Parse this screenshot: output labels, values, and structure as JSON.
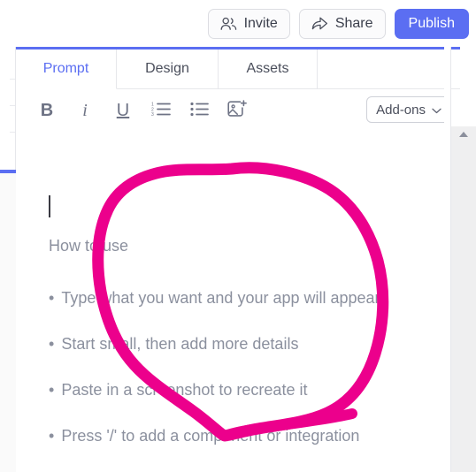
{
  "topbar": {
    "invite_label": "Invite",
    "invite_icon": "people-icon",
    "share_label": "Share",
    "share_icon": "share-arrow-icon",
    "publish_label": "Publish",
    "publish_color": "#5b6ef2"
  },
  "tabs": {
    "items": [
      {
        "label": "Prompt",
        "active": true
      },
      {
        "label": "Design",
        "active": false
      },
      {
        "label": "Assets",
        "active": false
      }
    ],
    "active_color": "#5b6ef2"
  },
  "toolbar": {
    "bold_label": "B",
    "italic_label": "i",
    "underline_label": "U",
    "ordered_list_icon": "numbered-list-icon",
    "bullet_list_icon": "bulleted-list-icon",
    "image_icon": "add-image-icon",
    "addons_label": "Add-ons",
    "addons_chevron": "chevron-down-icon"
  },
  "editor": {
    "heading": "How to use",
    "bullets": [
      {
        "marker": "•",
        "text": "Type what you want and your app will appear"
      },
      {
        "marker": "•",
        "text": "Start small, then add more details"
      },
      {
        "marker": "•",
        "text": "Paste in a screenshot to recreate it"
      },
      {
        "marker": "•",
        "text": "Press '/' to add a component or integration"
      }
    ]
  },
  "scrollbar": {
    "up_arrow_icon": "scroll-up-arrow-icon"
  },
  "annotation": {
    "type": "hand-drawn-circle",
    "color": "#EC008C",
    "stroke_width": 13
  }
}
